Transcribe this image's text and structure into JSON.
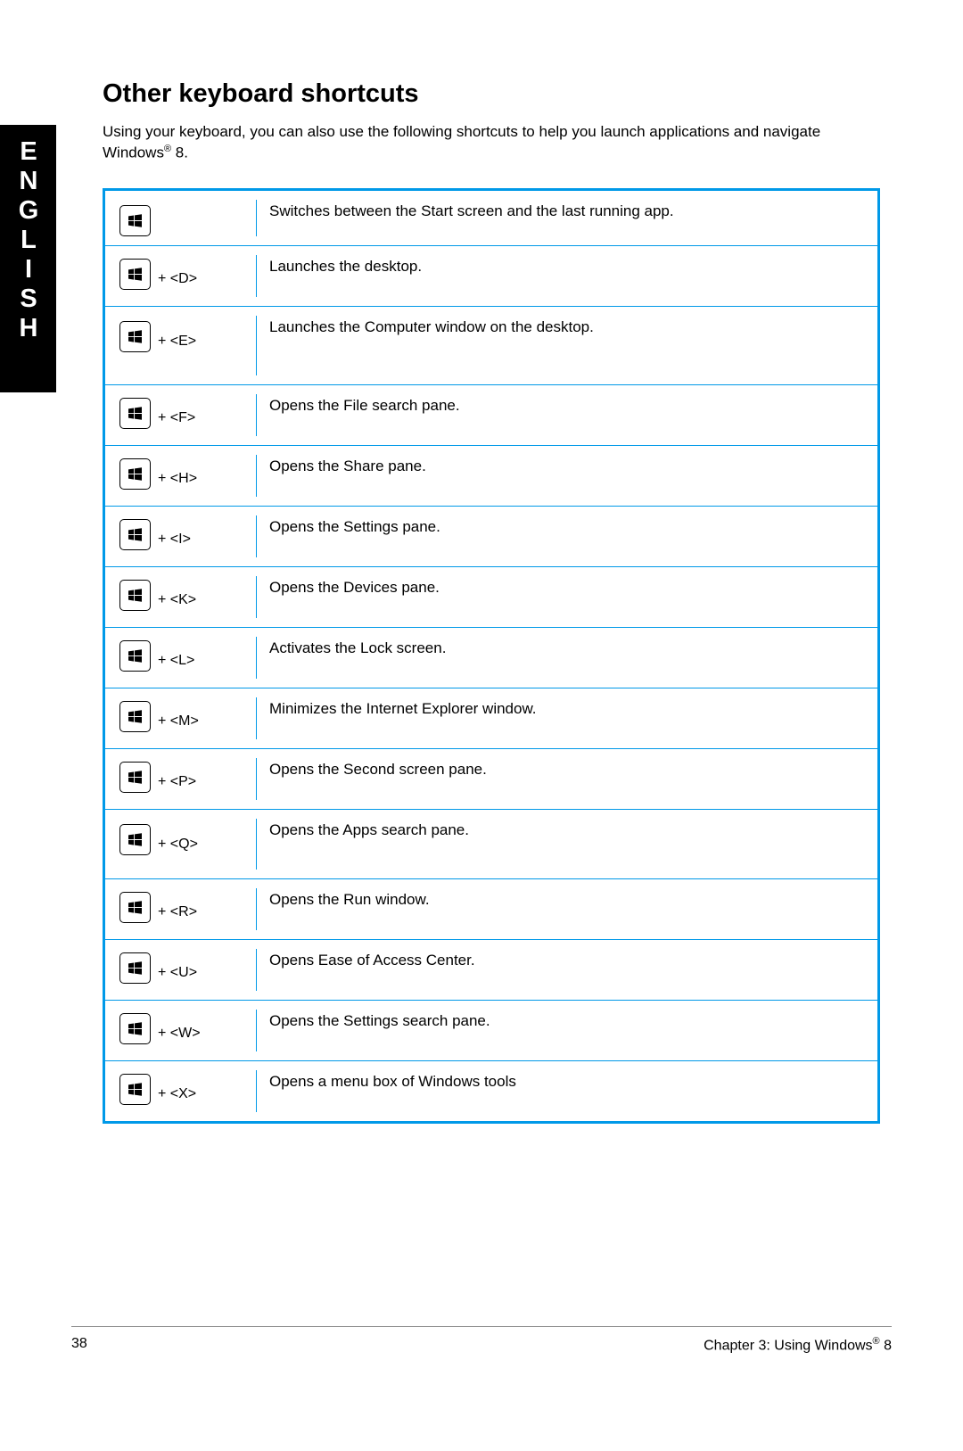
{
  "sidebar": {
    "language": "ENGLISH"
  },
  "page": {
    "title": "Other keyboard shortcuts",
    "intro_part1": "Using your keyboard, you can also use the following shortcuts to help you launch applications and navigate Windows",
    "intro_reg": "®",
    "intro_part2": " 8."
  },
  "shortcuts": [
    {
      "combo": "",
      "desc": "Switches between the Start screen and the last running app."
    },
    {
      "combo": " + <D>",
      "desc": "Launches the desktop."
    },
    {
      "combo": " + <E>",
      "desc": "Launches the Computer window on the desktop."
    },
    {
      "combo": " + <F>",
      "desc": "Opens the File search pane."
    },
    {
      "combo": " + <H>",
      "desc": "Opens the Share pane."
    },
    {
      "combo": " + <I>",
      "desc": "Opens the Settings pane."
    },
    {
      "combo": " + <K>",
      "desc": "Opens the Devices pane."
    },
    {
      "combo": " + <L>",
      "desc": "Activates the Lock screen."
    },
    {
      "combo": " + <M>",
      "desc": "Minimizes the Internet Explorer window."
    },
    {
      "combo": " + <P>",
      "desc": "Opens the Second screen pane."
    },
    {
      "combo": " + <Q>",
      "desc": "Opens the Apps search pane."
    },
    {
      "combo": " + <R>",
      "desc": "Opens the Run window."
    },
    {
      "combo": " + <U>",
      "desc": "Opens Ease of Access Center."
    },
    {
      "combo": " + <W>",
      "desc": "Opens the Settings search pane."
    },
    {
      "combo": " + <X>",
      "desc": "Opens a menu box of Windows tools"
    }
  ],
  "footer": {
    "page_number": "38",
    "chapter_part1": "Chapter 3: Using Windows",
    "chapter_reg": "®",
    "chapter_part2": " 8"
  }
}
